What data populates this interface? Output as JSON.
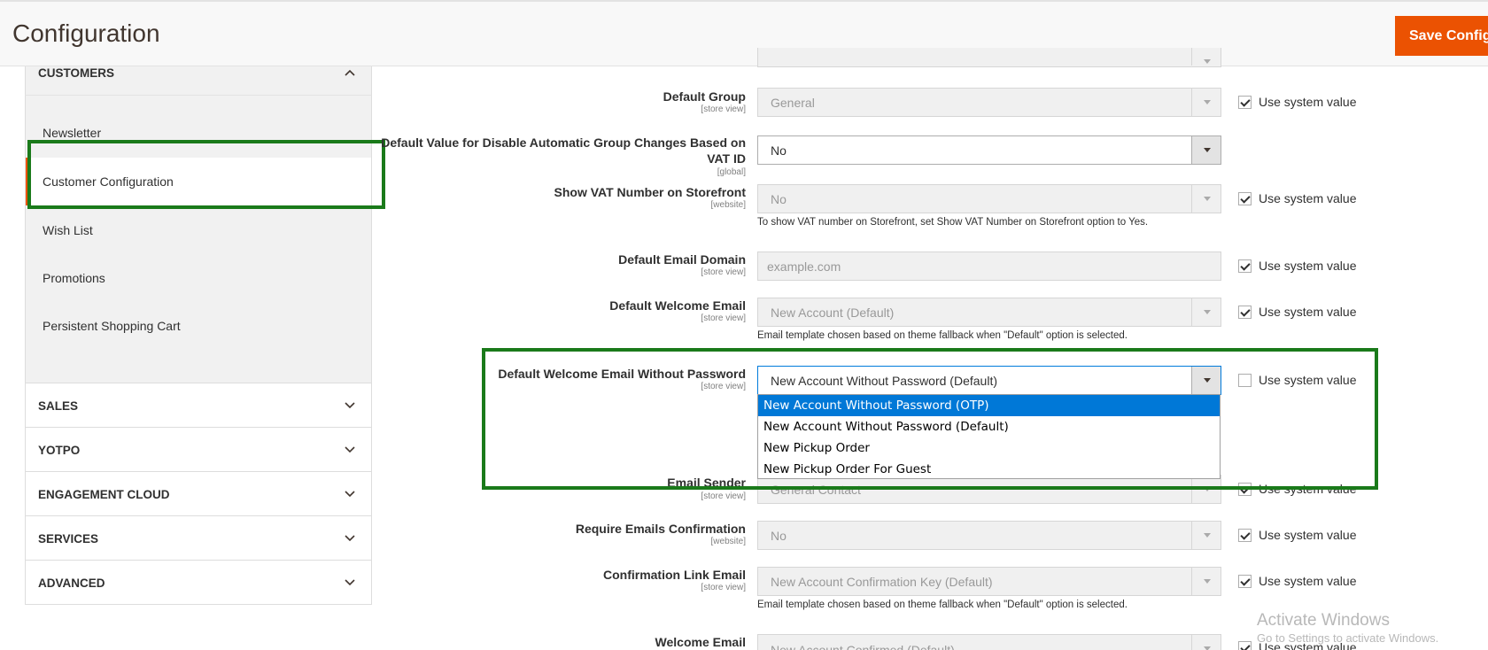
{
  "header": {
    "title": "Configuration",
    "save_label": "Save Config"
  },
  "sidebar": {
    "customers_label": "CUSTOMERS",
    "items": [
      "Newsletter",
      "Customer Configuration",
      "Wish List",
      "Promotions",
      "Persistent Shopping Cart"
    ],
    "sections": [
      "SALES",
      "YOTPO",
      "ENGAGEMENT CLOUD",
      "SERVICES",
      "ADVANCED"
    ]
  },
  "form": {
    "default_group": {
      "label": "Default Group",
      "scope": "[store view]",
      "value": "General",
      "use_system": "Use system value"
    },
    "disable_auto_group": {
      "label_line1": "Default Value for Disable Automatic Group Changes Based on",
      "label_line2": "VAT ID",
      "scope": "[global]",
      "value": "No"
    },
    "show_vat": {
      "label": "Show VAT Number on Storefront",
      "scope": "[website]",
      "value": "No",
      "use_system": "Use system value",
      "note": "To show VAT number on Storefront, set Show VAT Number on Storefront option to Yes."
    },
    "email_domain": {
      "label": "Default Email Domain",
      "scope": "[store view]",
      "placeholder": "example.com",
      "use_system": "Use system value"
    },
    "welcome_email": {
      "label": "Default Welcome Email",
      "scope": "[store view]",
      "value": "New Account (Default)",
      "use_system": "Use system value",
      "note": "Email template chosen based on theme fallback when \"Default\" option is selected."
    },
    "welcome_no_pw": {
      "label": "Default Welcome Email Without Password",
      "scope": "[store view]",
      "value": "New Account Without Password (Default)",
      "use_system": "Use system value",
      "options": [
        "New Account Without Password (OTP)",
        "New Account Without Password (Default)",
        "New Pickup Order",
        "New Pickup Order For Guest"
      ]
    },
    "email_sender": {
      "label": "Email Sender",
      "scope": "[store view]",
      "value": "General Contact",
      "use_system": "Use system value"
    },
    "require_confirm": {
      "label": "Require Emails Confirmation",
      "scope": "[website]",
      "value": "No",
      "use_system": "Use system value"
    },
    "confirm_link": {
      "label": "Confirmation Link Email",
      "scope": "[store view]",
      "value": "New Account Confirmation Key (Default)",
      "use_system": "Use system value",
      "note": "Email template chosen based on theme fallback when \"Default\" option is selected."
    },
    "welcome_confirmed": {
      "label": "Welcome Email",
      "value": "New Account Confirmed (Default)",
      "use_system": "Use system value"
    }
  },
  "watermark": {
    "line1": "Activate Windows",
    "line2": "Go to Settings to activate Windows."
  },
  "colors": {
    "accent": "#eb5202",
    "highlight_box": "#1a7a1a",
    "selected_option": "#0078d7"
  }
}
